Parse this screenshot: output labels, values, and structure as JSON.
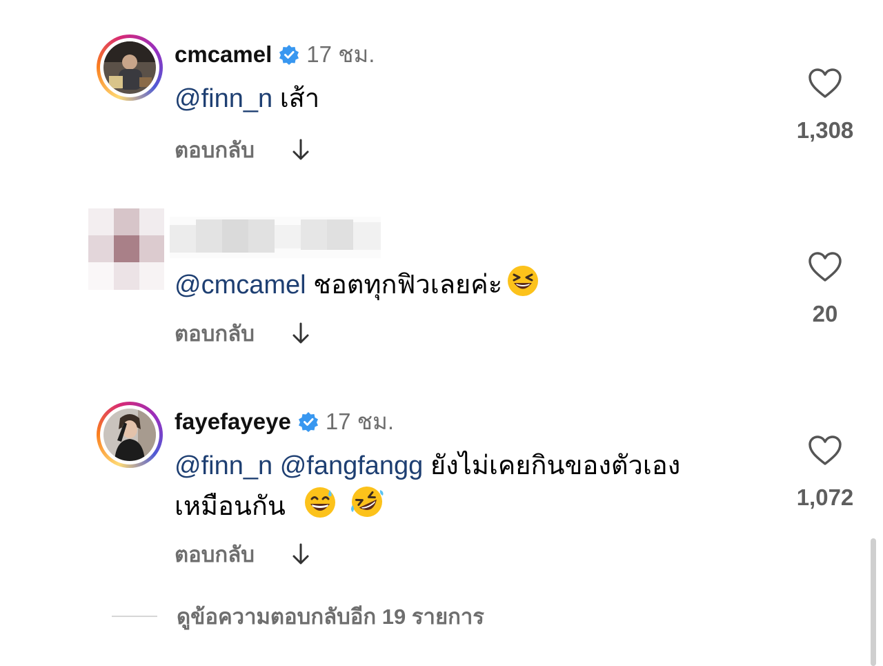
{
  "comments": [
    {
      "username": "cmcamel",
      "verified": true,
      "time": "17 ชม.",
      "mentions": [
        "@finn_n"
      ],
      "text": "เส้า",
      "reply_label": "ตอบกลับ",
      "likes": "1,308",
      "avatar": "photo"
    },
    {
      "username": "",
      "verified": false,
      "time": "",
      "mentions": [
        "@cmcamel"
      ],
      "text": "ชอตทุกฟิวเลยค่ะ",
      "emoji": [
        "laughing-squint-emoji"
      ],
      "reply_label": "ตอบกลับ",
      "likes": "20",
      "avatar": "pixelated"
    },
    {
      "username": "fayefayeye",
      "verified": true,
      "time": "17 ชม.",
      "mentions": [
        "@finn_n",
        "@fangfangg"
      ],
      "text_line1": "ยังไม่เคยกินของตัวเอง",
      "text_line2": "เหมือนกัน",
      "emoji": [
        "grinning-sweat-emoji",
        "rolling-laughing-emoji"
      ],
      "reply_label": "ตอบกลับ",
      "likes": "1,072",
      "avatar": "photo"
    }
  ],
  "more_replies": "ดูข้อความตอบกลับอีก 19 รายการ",
  "colors": {
    "mention": "#1e3f72",
    "muted": "#6e6e6e",
    "verified": "#3897f0"
  },
  "icons": [
    "heart-outline-icon",
    "down-arrow-icon",
    "verified-badge-icon"
  ]
}
